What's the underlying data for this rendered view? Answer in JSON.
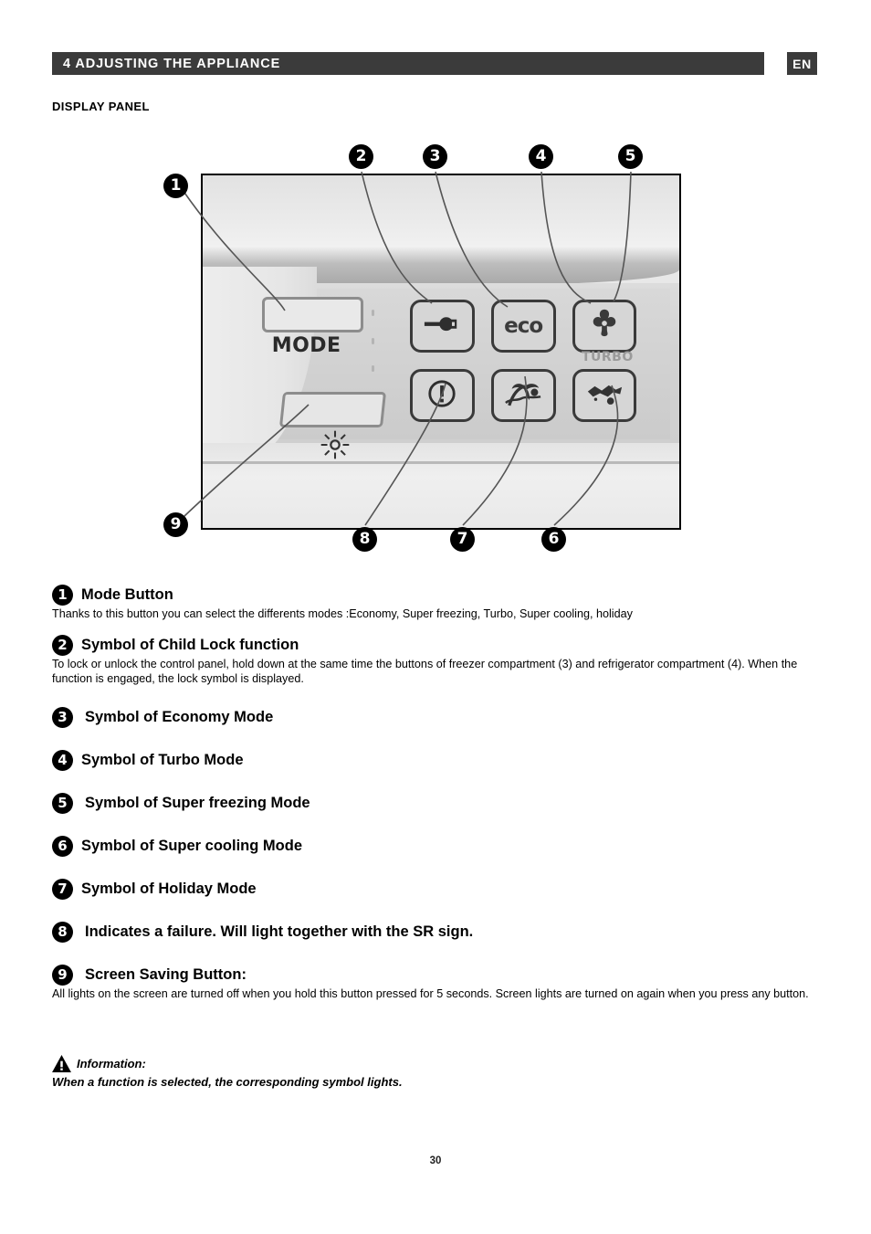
{
  "header": {
    "title": "4 ADJUSTING THE APPLIANCE",
    "language_badge": "EN",
    "bar_color": "#3b3b3b",
    "text_color": "#ffffff"
  },
  "section": {
    "label": "DISPLAY PANEL"
  },
  "figure": {
    "callouts": [
      {
        "number": "1"
      },
      {
        "number": "2"
      },
      {
        "number": "3"
      },
      {
        "number": "4"
      },
      {
        "number": "5"
      },
      {
        "number": "6"
      },
      {
        "number": "7"
      },
      {
        "number": "8"
      },
      {
        "number": "9"
      }
    ],
    "panel": {
      "mode_label": "MODE",
      "eco_label": "eco",
      "turbo_label": "TURBO",
      "icons": [
        "key-child-lock-icon",
        "eco-icon",
        "turbo-fan-icon",
        "warning-exclamation-icon",
        "holiday-palm-icon",
        "snowflake-super-cooling-icon",
        "sun-brightness-icon"
      ]
    }
  },
  "descriptions": [
    {
      "number": "1",
      "title": "Mode Button",
      "body": "Thanks to this button you can select the differents modes :Economy, Super freezing, Turbo, Super cooling, holiday"
    },
    {
      "number": "2",
      "title": "Symbol of Child Lock function",
      "body": "To lock or unlock the control panel, hold down at the same time the buttons of freezer compartment (3) and refrigerator compartment (4). When the function is engaged, the lock symbol is displayed."
    },
    {
      "number": "3",
      "title": "Symbol of Economy Mode",
      "body": ""
    },
    {
      "number": "4",
      "title": "Symbol of Turbo Mode",
      "body": ""
    },
    {
      "number": "5",
      "title": "Symbol of Super freezing Mode",
      "body": ""
    },
    {
      "number": "6",
      "title": "Symbol of Super cooling Mode",
      "body": ""
    },
    {
      "number": "7",
      "title": "Symbol of Holiday Mode",
      "body": ""
    },
    {
      "number": "8",
      "title": "Indicates a failure. Will light together with the SR sign.",
      "body": ""
    },
    {
      "number": "9",
      "title": "Screen Saving Button:",
      "body": "All lights on the screen are turned off when you hold this button pressed for 5 seconds. Screen lights are turned on again when you press any button."
    }
  ],
  "information": {
    "label": "Information:",
    "text": "When a function is selected, the corresponding symbol lights."
  },
  "footer": {
    "page_number": "30"
  }
}
